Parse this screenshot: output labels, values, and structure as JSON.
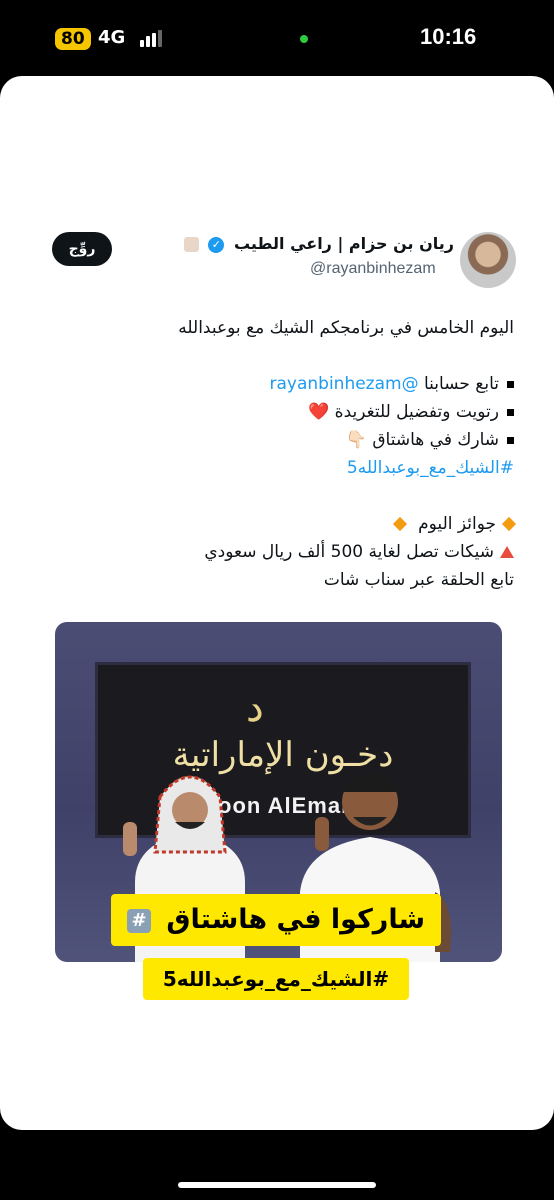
{
  "status_bar": {
    "battery": "80",
    "network": "4G",
    "time": "10:16"
  },
  "profile": {
    "name": "ريان بن حزام | راعي الطيب",
    "handle": "@rayanbinhezam",
    "verified_icon": "verified-badge-icon"
  },
  "follow_button": {
    "label": "روِّج"
  },
  "tweet": {
    "line1": "اليوم الخامس في برنامجكم الشيك مع بوعبدالله",
    "bullet1_prefix": "تابع حسابنا",
    "bullet1_mention": "@rayanbinhezam",
    "bullet2": "رتويت وتفضيل للتغريدة",
    "bullet2_emoji": "❤️",
    "bullet3": "شارك في هاشتاق",
    "bullet3_emoji": "👇🏻",
    "hashtag": "#الشيك_مع_بوعبدالله5",
    "prizes": "جوائز اليوم",
    "checks": "شيكات تصل لغاية 500 ألف ريال سعودي",
    "follow_episode": "تابع الحلقة عبر سناب شات"
  },
  "media": {
    "screen_mark": "د",
    "screen_text_ar": "دخـون الإماراتية",
    "screen_text_en": "Dkhoon AlEmaratia",
    "overlay_line1": "شاركوا في هاشتاق",
    "overlay_hash_icon": "#️⃣",
    "overlay_line2": "#الشيك_مع_بوعبدالله5"
  },
  "colors": {
    "link": "#1d9bf0",
    "highlight": "#ffe800",
    "verified": "#1d9bf0"
  }
}
